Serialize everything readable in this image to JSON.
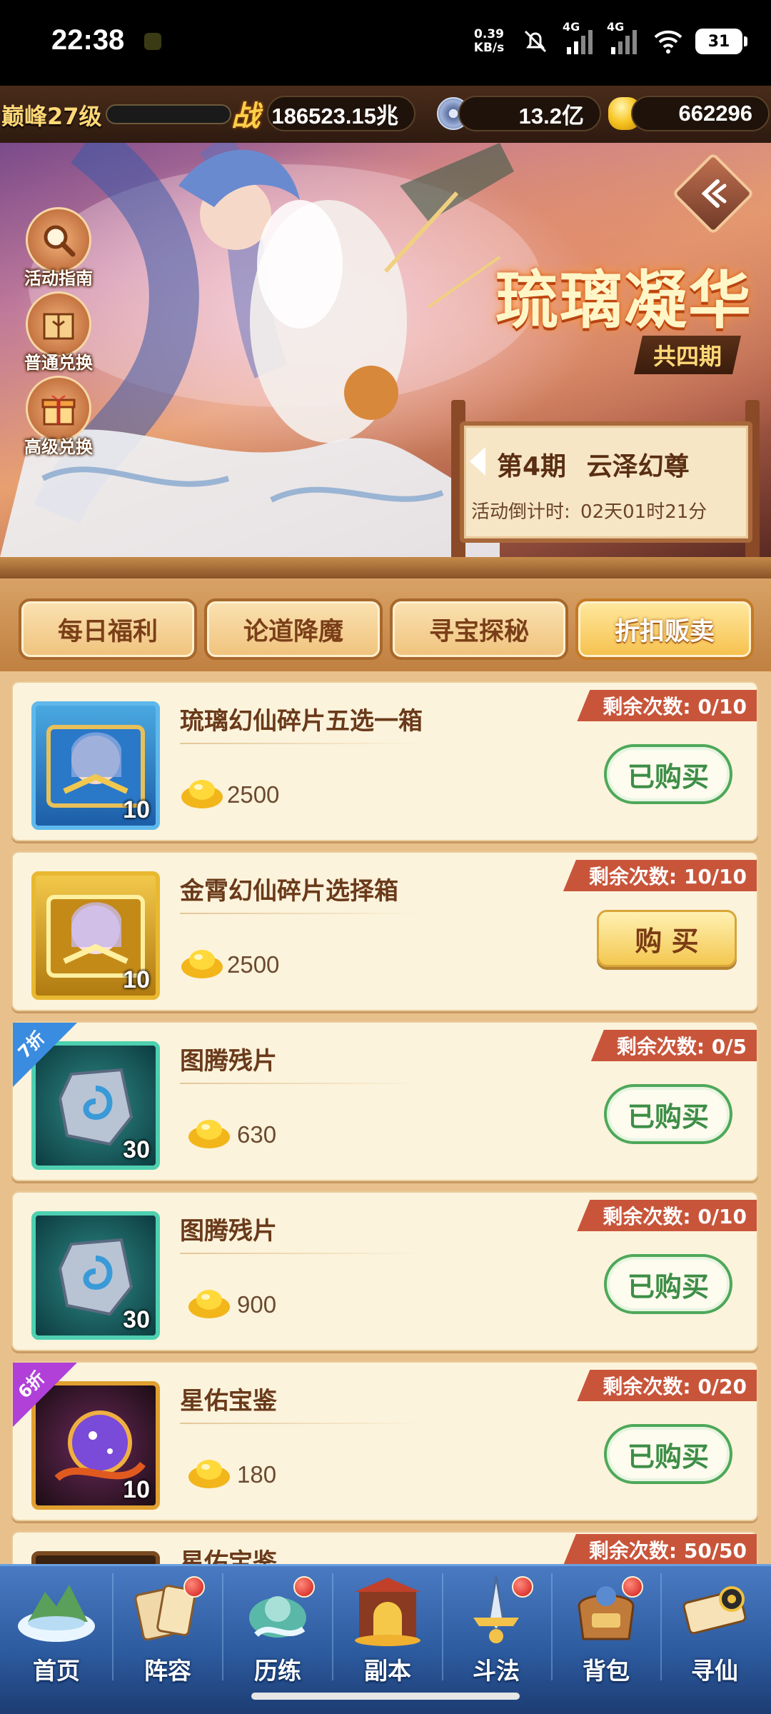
{
  "status_bar": {
    "time": "22:38",
    "net_speed_value": "0.39",
    "net_speed_unit": "KB/s",
    "signal1_label": "4G",
    "signal2_label": "4G",
    "battery": "31",
    "icons": [
      "mute-icon",
      "signal-icon",
      "signal-icon",
      "wifi-icon",
      "battery-icon"
    ]
  },
  "resources": {
    "level": "巅峰27级",
    "exp_progress": 0,
    "power_icon_text": "战",
    "power": "186523.15兆",
    "coins": "13.2亿",
    "gold": "662296"
  },
  "banner": {
    "side_buttons": [
      {
        "label": "活动指南",
        "icon": "magnifier-icon"
      },
      {
        "label": "普通兑换",
        "icon": "gift-box-icon"
      },
      {
        "label": "高级兑换",
        "icon": "gift-icon"
      }
    ],
    "title": "琉璃凝华",
    "subtitle": "共四期",
    "period": "第4期",
    "period_name": "云泽幻尊",
    "countdown_label": "活动倒计时:",
    "countdown": "02天01时21分"
  },
  "tabs": [
    {
      "label": "每日福利",
      "active": false
    },
    {
      "label": "论道降魔",
      "active": false
    },
    {
      "label": "寻宝探秘",
      "active": false
    },
    {
      "label": "折扣贩卖",
      "active": true
    }
  ],
  "shop_items": [
    {
      "name": "琉璃幻仙碎片五选一箱",
      "count": "10",
      "price": "2500",
      "remaining": "剩余次数: 0/10",
      "button": "已购买",
      "status": "bought",
      "discount": ""
    },
    {
      "name": "金霄幻仙碎片选择箱",
      "count": "10",
      "price": "2500",
      "remaining": "剩余次数: 10/10",
      "button": "购 买",
      "status": "can-buy",
      "discount": ""
    },
    {
      "name": "图腾残片",
      "count": "30",
      "price": "630",
      "remaining": "剩余次数: 0/5",
      "button": "已购买",
      "status": "bought",
      "discount": "7折"
    },
    {
      "name": "图腾残片",
      "count": "30",
      "price": "900",
      "remaining": "剩余次数: 0/10",
      "button": "已购买",
      "status": "bought",
      "discount": ""
    },
    {
      "name": "星佑宝鉴",
      "count": "10",
      "price": "180",
      "remaining": "剩余次数: 0/20",
      "button": "已购买",
      "status": "bought",
      "discount": "6折"
    },
    {
      "name": "星佑宝鉴",
      "count": "",
      "price": "",
      "remaining": "剩余次数: 50/50",
      "button": "",
      "status": "partial",
      "discount": ""
    }
  ],
  "bottom_nav": [
    {
      "label": "首页",
      "icon": "home-island-icon",
      "badge": false
    },
    {
      "label": "阵容",
      "icon": "formation-cards-icon",
      "badge": true
    },
    {
      "label": "历练",
      "icon": "training-icon",
      "badge": true
    },
    {
      "label": "副本",
      "icon": "dungeon-gate-icon",
      "badge": false
    },
    {
      "label": "斗法",
      "icon": "battle-sword-icon",
      "badge": true
    },
    {
      "label": "背包",
      "icon": "backpack-icon",
      "badge": true
    },
    {
      "label": "寻仙",
      "icon": "scroll-icon",
      "badge": false
    }
  ],
  "colors": {
    "bought_green": "#3d8e46",
    "remaining_tag": "#c8553a",
    "active_tab": "#f6c04c",
    "nav_blue": "#2c5a9e"
  }
}
